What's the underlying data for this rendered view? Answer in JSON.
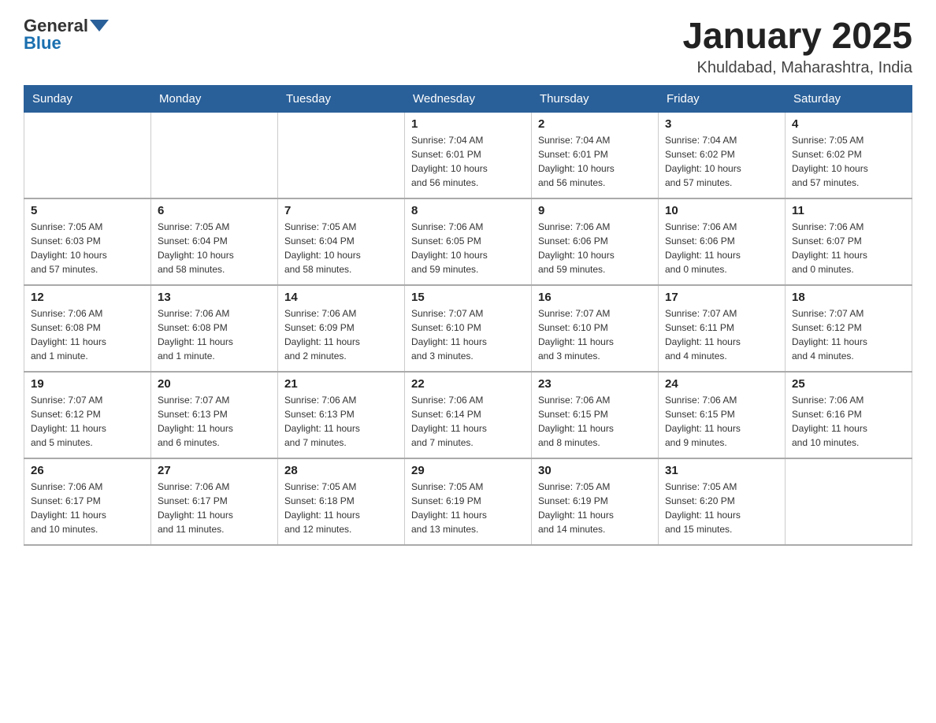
{
  "header": {
    "logo_general": "General",
    "logo_blue": "Blue",
    "month_title": "January 2025",
    "location": "Khuldabad, Maharashtra, India"
  },
  "days_of_week": [
    "Sunday",
    "Monday",
    "Tuesday",
    "Wednesday",
    "Thursday",
    "Friday",
    "Saturday"
  ],
  "weeks": [
    [
      {
        "day": "",
        "info": ""
      },
      {
        "day": "",
        "info": ""
      },
      {
        "day": "",
        "info": ""
      },
      {
        "day": "1",
        "info": "Sunrise: 7:04 AM\nSunset: 6:01 PM\nDaylight: 10 hours\nand 56 minutes."
      },
      {
        "day": "2",
        "info": "Sunrise: 7:04 AM\nSunset: 6:01 PM\nDaylight: 10 hours\nand 56 minutes."
      },
      {
        "day": "3",
        "info": "Sunrise: 7:04 AM\nSunset: 6:02 PM\nDaylight: 10 hours\nand 57 minutes."
      },
      {
        "day": "4",
        "info": "Sunrise: 7:05 AM\nSunset: 6:02 PM\nDaylight: 10 hours\nand 57 minutes."
      }
    ],
    [
      {
        "day": "5",
        "info": "Sunrise: 7:05 AM\nSunset: 6:03 PM\nDaylight: 10 hours\nand 57 minutes."
      },
      {
        "day": "6",
        "info": "Sunrise: 7:05 AM\nSunset: 6:04 PM\nDaylight: 10 hours\nand 58 minutes."
      },
      {
        "day": "7",
        "info": "Sunrise: 7:05 AM\nSunset: 6:04 PM\nDaylight: 10 hours\nand 58 minutes."
      },
      {
        "day": "8",
        "info": "Sunrise: 7:06 AM\nSunset: 6:05 PM\nDaylight: 10 hours\nand 59 minutes."
      },
      {
        "day": "9",
        "info": "Sunrise: 7:06 AM\nSunset: 6:06 PM\nDaylight: 10 hours\nand 59 minutes."
      },
      {
        "day": "10",
        "info": "Sunrise: 7:06 AM\nSunset: 6:06 PM\nDaylight: 11 hours\nand 0 minutes."
      },
      {
        "day": "11",
        "info": "Sunrise: 7:06 AM\nSunset: 6:07 PM\nDaylight: 11 hours\nand 0 minutes."
      }
    ],
    [
      {
        "day": "12",
        "info": "Sunrise: 7:06 AM\nSunset: 6:08 PM\nDaylight: 11 hours\nand 1 minute."
      },
      {
        "day": "13",
        "info": "Sunrise: 7:06 AM\nSunset: 6:08 PM\nDaylight: 11 hours\nand 1 minute."
      },
      {
        "day": "14",
        "info": "Sunrise: 7:06 AM\nSunset: 6:09 PM\nDaylight: 11 hours\nand 2 minutes."
      },
      {
        "day": "15",
        "info": "Sunrise: 7:07 AM\nSunset: 6:10 PM\nDaylight: 11 hours\nand 3 minutes."
      },
      {
        "day": "16",
        "info": "Sunrise: 7:07 AM\nSunset: 6:10 PM\nDaylight: 11 hours\nand 3 minutes."
      },
      {
        "day": "17",
        "info": "Sunrise: 7:07 AM\nSunset: 6:11 PM\nDaylight: 11 hours\nand 4 minutes."
      },
      {
        "day": "18",
        "info": "Sunrise: 7:07 AM\nSunset: 6:12 PM\nDaylight: 11 hours\nand 4 minutes."
      }
    ],
    [
      {
        "day": "19",
        "info": "Sunrise: 7:07 AM\nSunset: 6:12 PM\nDaylight: 11 hours\nand 5 minutes."
      },
      {
        "day": "20",
        "info": "Sunrise: 7:07 AM\nSunset: 6:13 PM\nDaylight: 11 hours\nand 6 minutes."
      },
      {
        "day": "21",
        "info": "Sunrise: 7:06 AM\nSunset: 6:13 PM\nDaylight: 11 hours\nand 7 minutes."
      },
      {
        "day": "22",
        "info": "Sunrise: 7:06 AM\nSunset: 6:14 PM\nDaylight: 11 hours\nand 7 minutes."
      },
      {
        "day": "23",
        "info": "Sunrise: 7:06 AM\nSunset: 6:15 PM\nDaylight: 11 hours\nand 8 minutes."
      },
      {
        "day": "24",
        "info": "Sunrise: 7:06 AM\nSunset: 6:15 PM\nDaylight: 11 hours\nand 9 minutes."
      },
      {
        "day": "25",
        "info": "Sunrise: 7:06 AM\nSunset: 6:16 PM\nDaylight: 11 hours\nand 10 minutes."
      }
    ],
    [
      {
        "day": "26",
        "info": "Sunrise: 7:06 AM\nSunset: 6:17 PM\nDaylight: 11 hours\nand 10 minutes."
      },
      {
        "day": "27",
        "info": "Sunrise: 7:06 AM\nSunset: 6:17 PM\nDaylight: 11 hours\nand 11 minutes."
      },
      {
        "day": "28",
        "info": "Sunrise: 7:05 AM\nSunset: 6:18 PM\nDaylight: 11 hours\nand 12 minutes."
      },
      {
        "day": "29",
        "info": "Sunrise: 7:05 AM\nSunset: 6:19 PM\nDaylight: 11 hours\nand 13 minutes."
      },
      {
        "day": "30",
        "info": "Sunrise: 7:05 AM\nSunset: 6:19 PM\nDaylight: 11 hours\nand 14 minutes."
      },
      {
        "day": "31",
        "info": "Sunrise: 7:05 AM\nSunset: 6:20 PM\nDaylight: 11 hours\nand 15 minutes."
      },
      {
        "day": "",
        "info": ""
      }
    ]
  ]
}
